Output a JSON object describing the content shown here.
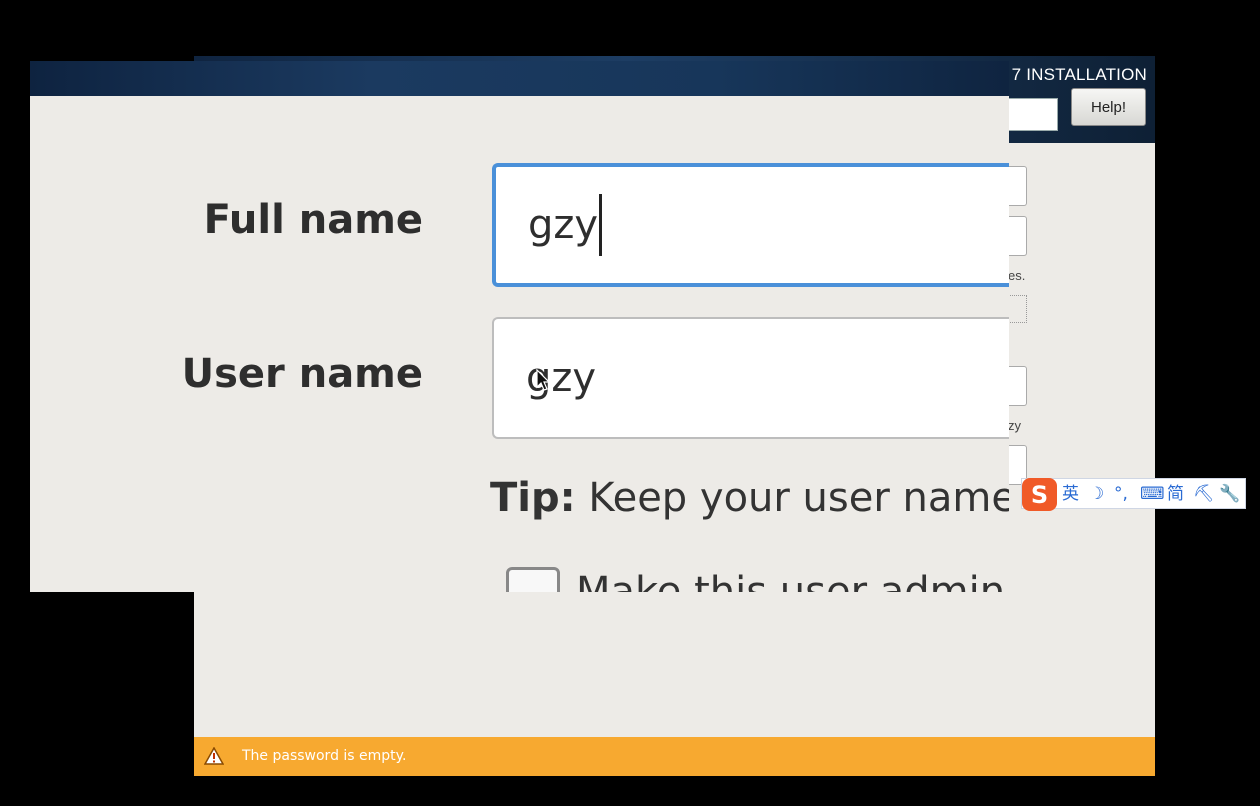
{
  "installer": {
    "title": "7 INSTALLATION",
    "help_label": "Help!",
    "fragments": [
      "es.",
      "zy"
    ],
    "warning": "The password is empty."
  },
  "form": {
    "full_name_label": "Full name",
    "full_name_value": "gzy",
    "user_name_label": "User name",
    "user_name_value": "gzy",
    "tip_label": "Tip:",
    "tip_text": " Keep your user name",
    "checkbox_label": "Make this user admin"
  },
  "ime": {
    "logo": "S",
    "items": [
      "英",
      "☽",
      "°,",
      "⌨",
      "简",
      "⛏",
      "🔧"
    ]
  },
  "colors": {
    "header_dark": "#0f2440",
    "warning_bar": "#f7a930",
    "focus_border": "#4a90d9",
    "panel_bg": "#edebe7",
    "ime_accent": "#2a6bd3",
    "ime_logo": "#f05a28"
  }
}
